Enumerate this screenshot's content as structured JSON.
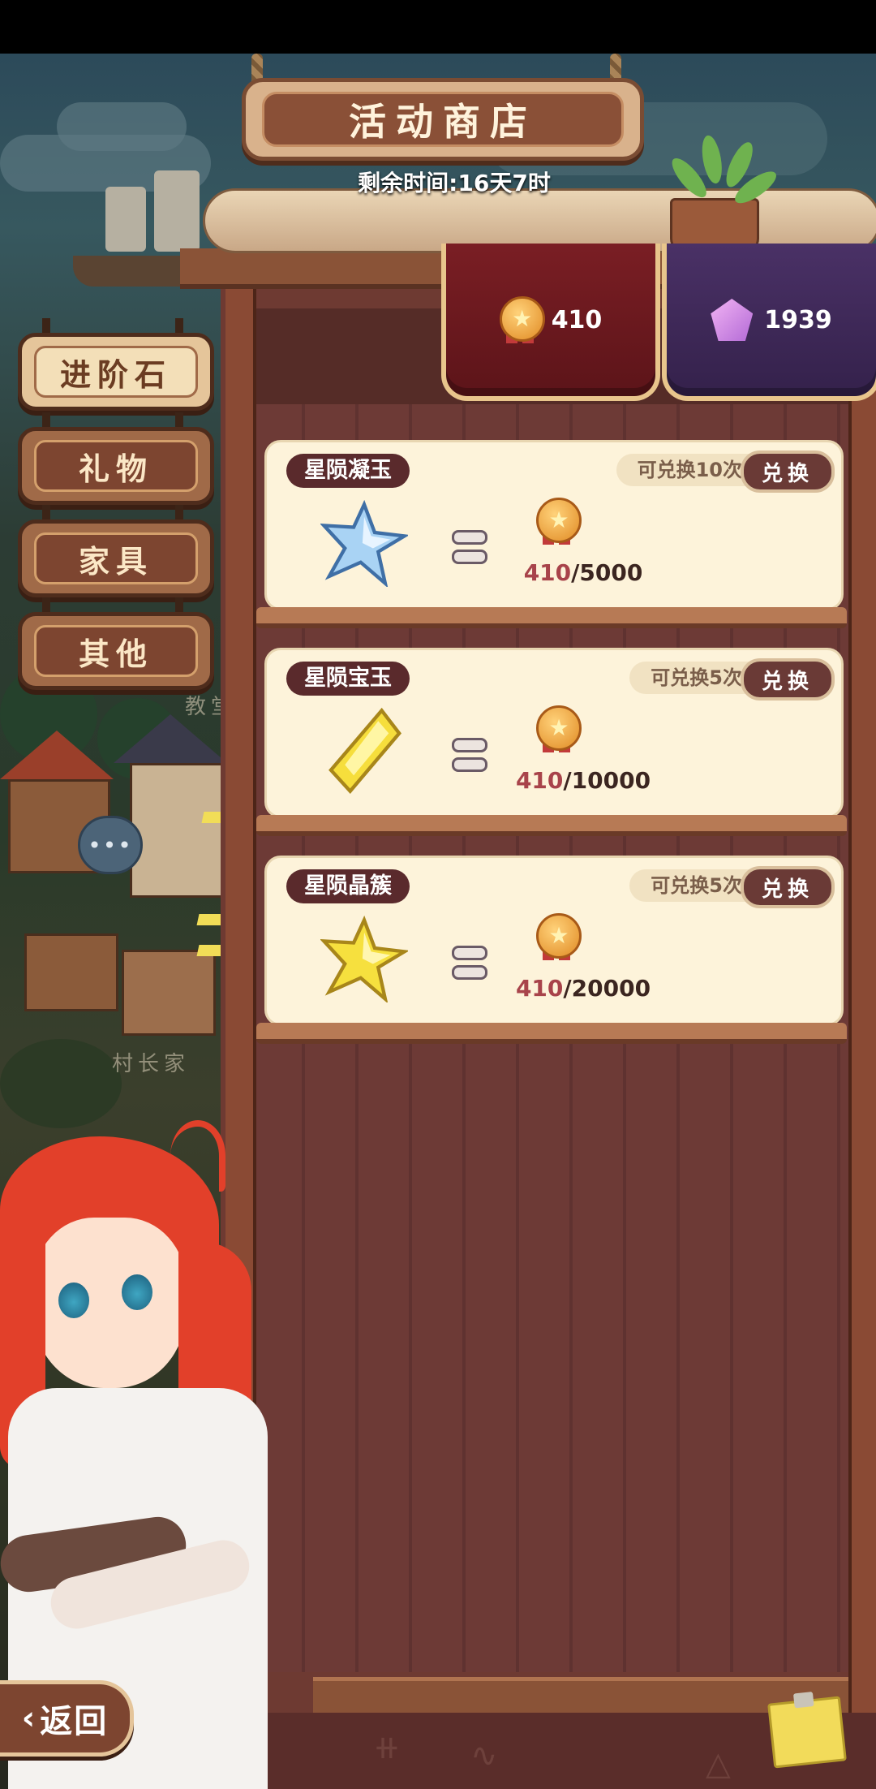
{
  "title": "活动商店",
  "timer": "剩余时间:16天7时",
  "currency": {
    "medal": {
      "icon": "star-medal-icon",
      "amount": "410"
    },
    "gem": {
      "icon": "purple-gem-icon",
      "amount": "1939"
    }
  },
  "categories": [
    {
      "label": "进阶石",
      "active": true
    },
    {
      "label": "礼物",
      "active": false
    },
    {
      "label": "家具",
      "active": false
    },
    {
      "label": "其他",
      "active": false
    }
  ],
  "items": [
    {
      "name": "星陨凝玉",
      "limit": "可兑换10次",
      "button": "兑换",
      "have": "410",
      "need": "/5000",
      "icon": "blue-star-crystal-icon"
    },
    {
      "name": "星陨宝玉",
      "limit": "可兑换5次",
      "button": "兑换",
      "have": "410",
      "need": "/10000",
      "icon": "yellow-crystal-icon"
    },
    {
      "name": "星陨晶簇",
      "limit": "可兑换5次",
      "button": "兑换",
      "have": "410",
      "need": "/20000",
      "icon": "yellow-star-crystal-icon"
    }
  ],
  "map_labels": {
    "top": "教堂",
    "bottom": "村长家"
  },
  "chat_bubble": "•••",
  "back": {
    "chevron": "‹",
    "label": "返回"
  },
  "colors": {
    "accent_red": "#a8434a",
    "card_bg": "#fdf3da",
    "wood": "#6e3a32"
  }
}
